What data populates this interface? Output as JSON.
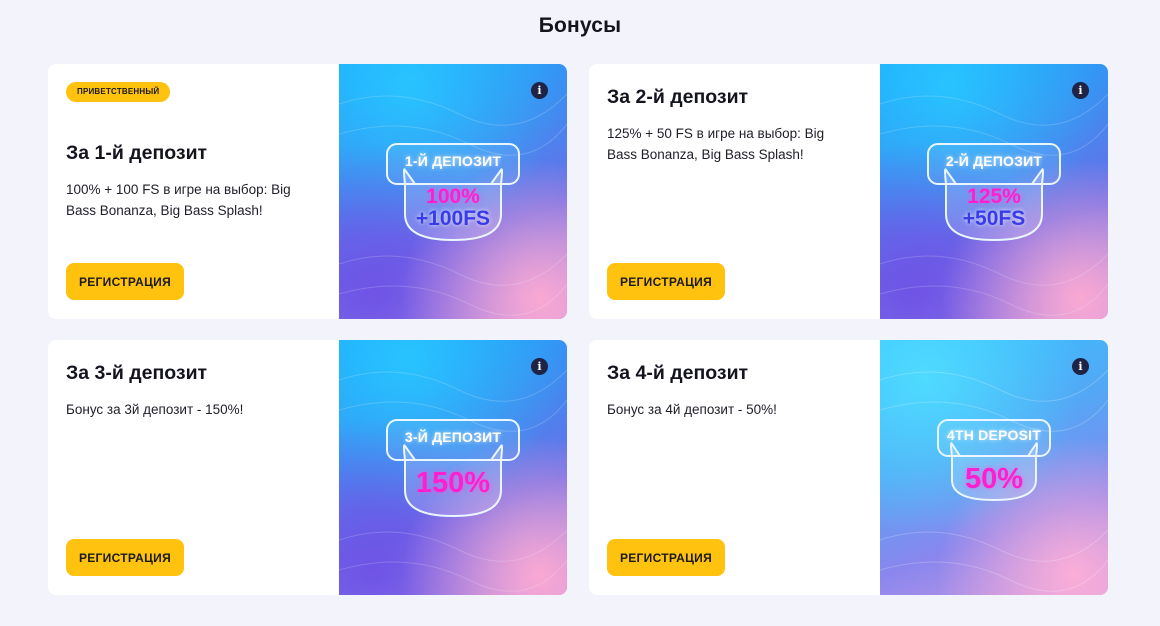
{
  "page": {
    "title": "Бонусы"
  },
  "cards": [
    {
      "badge": "ПРИВЕТСТВЕННЫЙ",
      "title": "За 1-й депозит",
      "description": "100% + 100 FS в игре на выбор: Big Bass Bonanza, Big Bass Splash!",
      "button": "РЕГИСТРАЦИЯ",
      "art_label": "1-Й ДЕПОЗИТ",
      "art_line1": "100%",
      "art_line2": "+100FS",
      "info_icon": "info-icon"
    },
    {
      "title": "За 2-й депозит",
      "description": "125% + 50 FS в игре на выбор: Big Bass Bonanza, Big Bass Splash!",
      "button": "РЕГИСТРАЦИЯ",
      "art_label": "2-Й ДЕПОЗИТ",
      "art_line1": "125%",
      "art_line2": "+50FS",
      "info_icon": "info-icon"
    },
    {
      "title": "За 3-й депозит",
      "description": "Бонус за 3й депозит - 150%!",
      "button": "РЕГИСТРАЦИЯ",
      "art_label": "3-Й ДЕПОЗИТ",
      "art_line1": "150%",
      "info_icon": "info-icon"
    },
    {
      "title": "За 4-й депозит",
      "description": "Бонус за 4й депозит - 50%!",
      "button": "РЕГИСТРАЦИЯ",
      "art_label": "4TH DEPOSIT",
      "art_line1": "50%",
      "info_icon": "info-icon"
    }
  ],
  "colors": {
    "accent": "#ffc20e",
    "background": "#f3f4fb",
    "neon_pink": "#ff1fd0",
    "neon_blue": "#3a3be8"
  }
}
